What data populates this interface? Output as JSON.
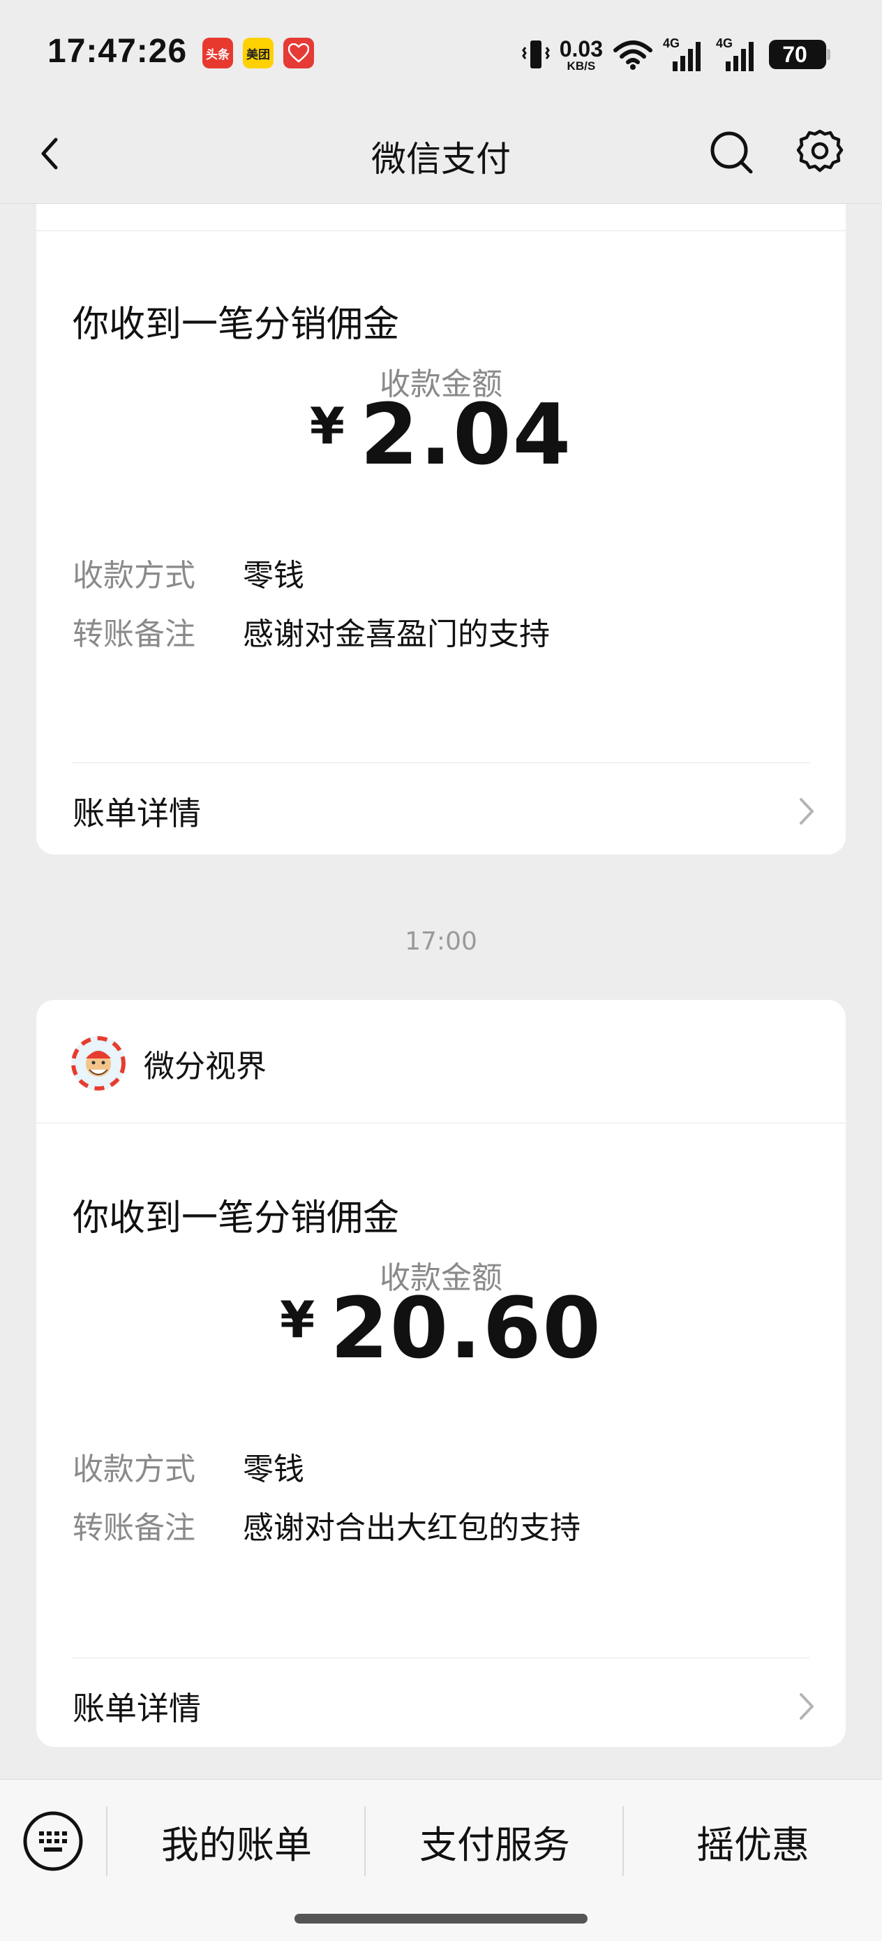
{
  "status_bar": {
    "time": "17:47:26",
    "apps": [
      {
        "label": "头条",
        "color": "#e8392f"
      },
      {
        "label": "美团",
        "color": "#ffd100"
      },
      {
        "label": "",
        "color": "#e53a35"
      }
    ],
    "net_speed_value": "0.03",
    "net_speed_unit": "KB/S",
    "network_1": "4G",
    "network_2": "4G",
    "battery": "70"
  },
  "nav": {
    "title": "微信支付",
    "back_icon": "chevron-left-icon",
    "search_icon": "search-icon",
    "settings_icon": "gear-icon"
  },
  "messages": [
    {
      "title": "你收到一笔分销佣金",
      "amount_label": "收款金额",
      "currency": "¥",
      "amount": "2.04",
      "method_label": "收款方式",
      "method_value": "零钱",
      "note_label": "转账备注",
      "note_value": "感谢对金喜盈门的支持",
      "detail_label": "账单详情"
    },
    {
      "merchant": "微分视界",
      "title": "你收到一笔分销佣金",
      "amount_label": "收款金额",
      "currency": "¥",
      "amount": "20.60",
      "method_label": "收款方式",
      "method_value": "零钱",
      "note_label": "转账备注",
      "note_value": "感谢对合出大红包的支持",
      "detail_label": "账单详情"
    }
  ],
  "timestamp": "17:00",
  "bottom_bar": {
    "keyboard_icon": "keyboard-icon",
    "items": [
      "我的账单",
      "支付服务",
      "摇优惠"
    ]
  }
}
